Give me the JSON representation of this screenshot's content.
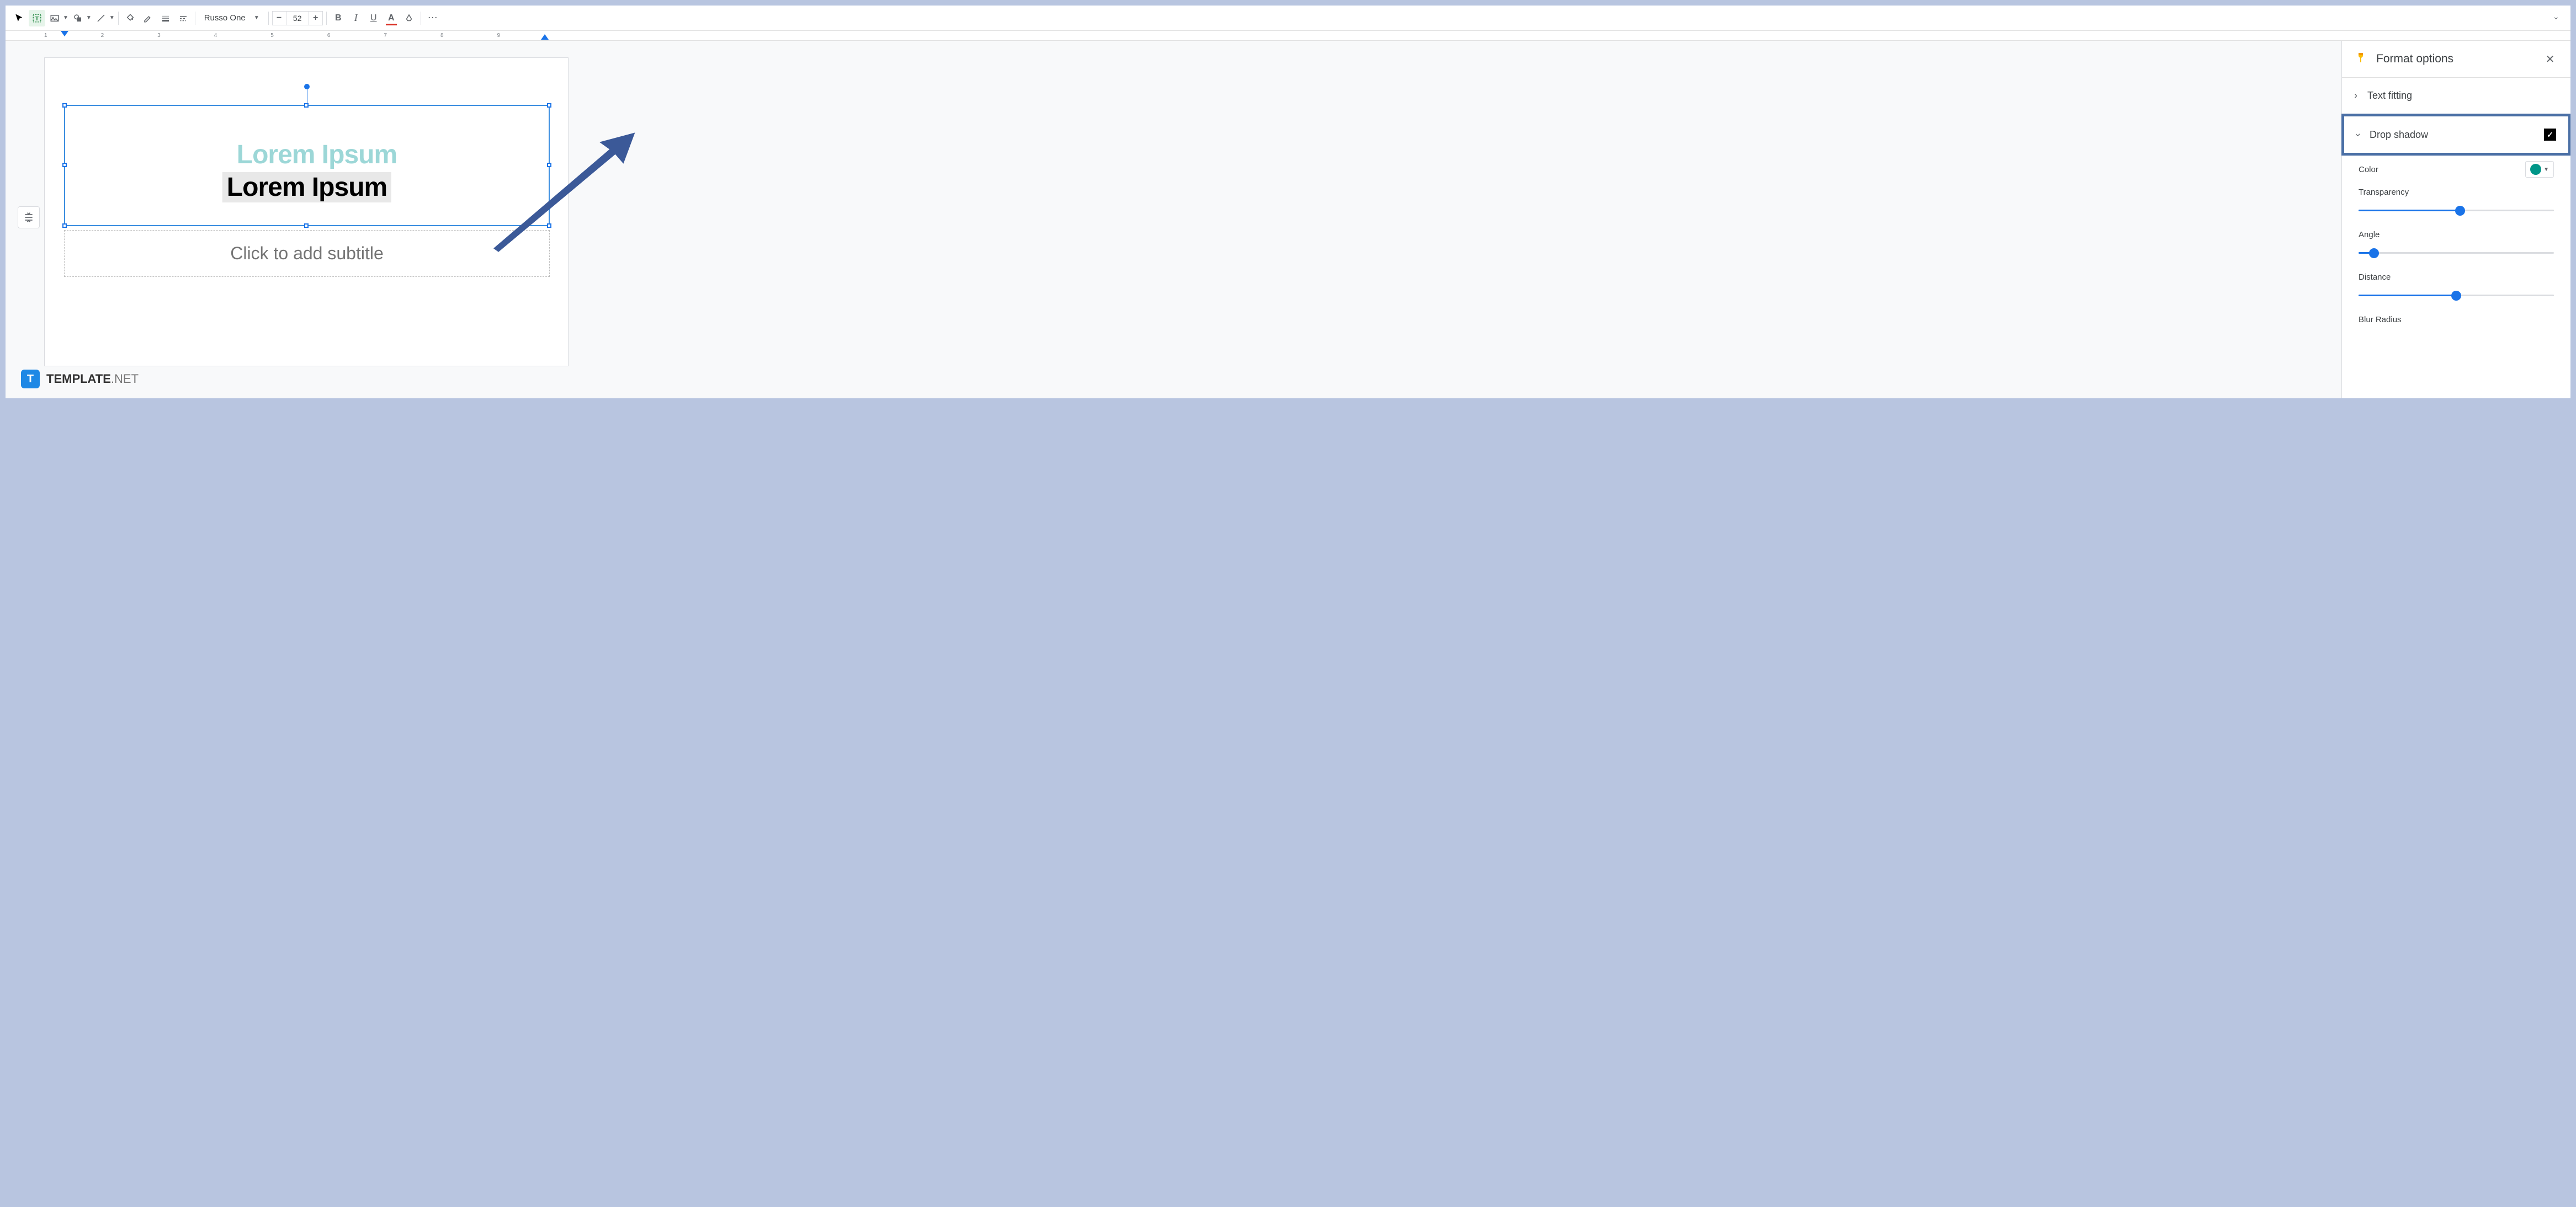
{
  "toolbar": {
    "font_name": "Russo One",
    "font_size": "52",
    "bold": "B",
    "italic": "I",
    "underline": "U",
    "textcolor": "A"
  },
  "ruler": {
    "marks": [
      "1",
      "2",
      "3",
      "4",
      "5",
      "6",
      "7",
      "8",
      "9"
    ]
  },
  "slide": {
    "title": "Lorem Ipsum",
    "subtitle_placeholder": "Click to add subtitle"
  },
  "panel": {
    "title": "Format options",
    "sections": {
      "text_fitting": {
        "label": "Text fitting"
      },
      "drop_shadow": {
        "label": "Drop shadow",
        "checked": true,
        "color_label": "Color",
        "color_value": "#009688",
        "transparency": {
          "label": "Transparency",
          "value": 52
        },
        "angle": {
          "label": "Angle",
          "value": 8
        },
        "distance": {
          "label": "Distance",
          "value": 50
        },
        "blur": {
          "label": "Blur Radius"
        }
      }
    }
  },
  "watermark": {
    "brand": "TEMPLATE",
    "suffix": ".NET",
    "icon": "T"
  }
}
